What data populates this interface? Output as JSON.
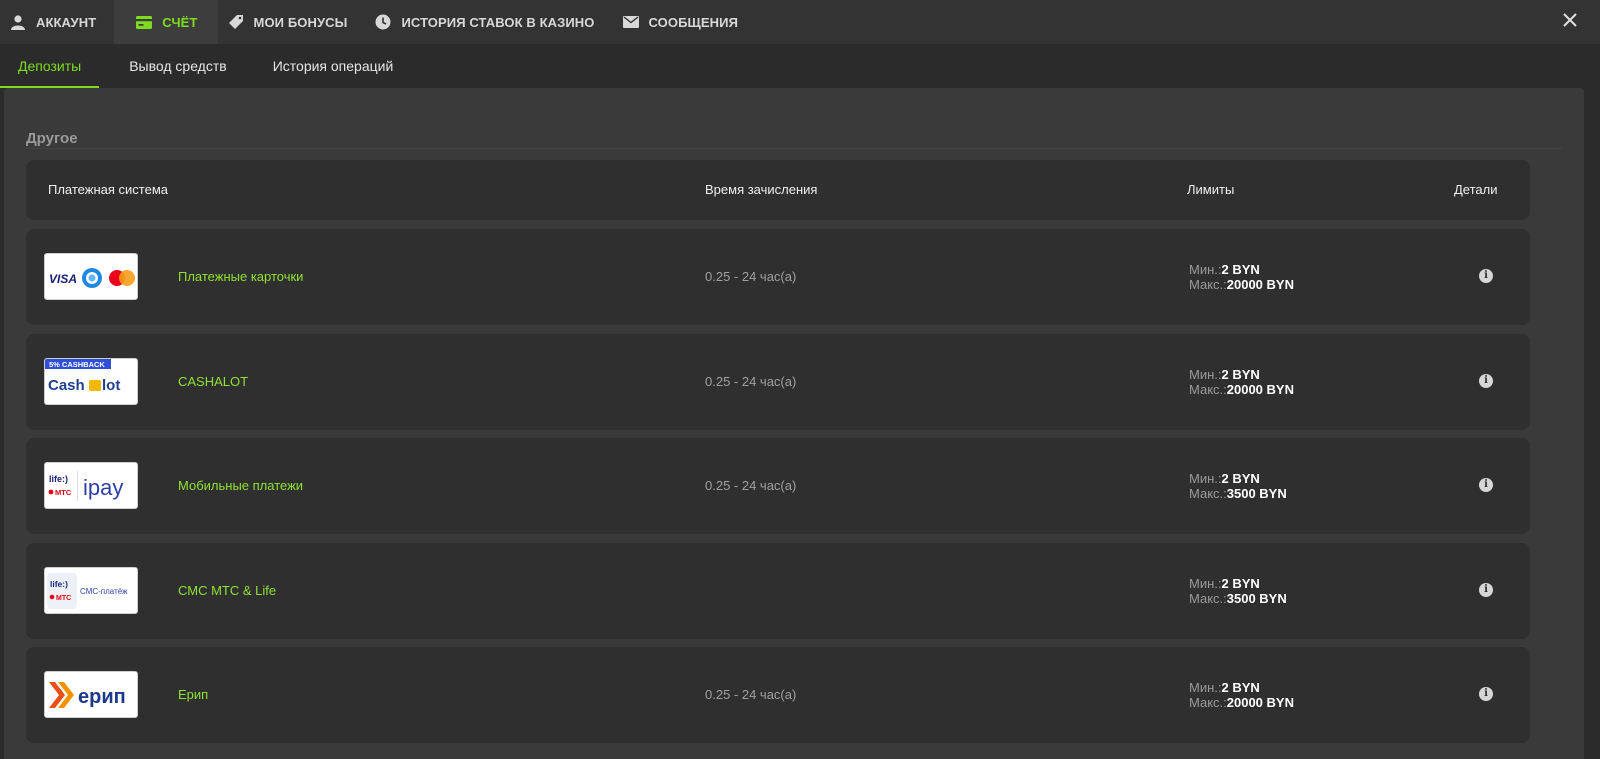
{
  "top_tabs": [
    {
      "label": "АККАУНТ",
      "icon": "user-icon"
    },
    {
      "label": "СЧЁТ",
      "icon": "card-icon",
      "active": true
    },
    {
      "label": "МОИ БОНУСЫ",
      "icon": "tag-icon"
    },
    {
      "label": "ИСТОРИЯ СТАВОК В КАЗИНО",
      "icon": "clock-icon"
    },
    {
      "label": "СООБЩЕНИЯ",
      "icon": "envelope-icon"
    }
  ],
  "close_icon": "close-icon",
  "sub_tabs": [
    {
      "label": "Депозиты",
      "active": true
    },
    {
      "label": "Вывод средств"
    },
    {
      "label": "История операций"
    }
  ],
  "section": {
    "title": "Другое"
  },
  "table_header": {
    "system": "Платежная система",
    "time": "Время зачисления",
    "limits": "Лимиты",
    "details": "Детали"
  },
  "methods": [
    {
      "name": "Платежные карточки",
      "time": "0.25 - 24 час(а)",
      "min_label": "Мин.:",
      "min": "2 BYN",
      "max_label": "Макс.:",
      "max": "20000 BYN",
      "logo": {
        "visa": "VISA"
      }
    },
    {
      "name": "CASHALOT",
      "time": "0.25 - 24 час(а)",
      "min_label": "Мин.:",
      "min": "2 BYN",
      "max_label": "Макс.:",
      "max": "20000 BYN",
      "logo": {
        "badge": "5% CASHBACK",
        "brand_left": "Cash",
        "brand_right": "lot"
      }
    },
    {
      "name": "Мобильные платежи",
      "time": "0.25 - 24 час(а)",
      "min_label": "Мин.:",
      "min": "2 BYN",
      "max_label": "Макс.:",
      "max": "3500 BYN",
      "logo": {
        "life": "life:)",
        "mts": "МТС",
        "ipay": "ipay"
      }
    },
    {
      "name": "СМС МТС & Life",
      "time": "",
      "min_label": "Мин.:",
      "min": "2 BYN",
      "max_label": "Макс.:",
      "max": "3500 BYN",
      "logo": {
        "life": "life:)",
        "mts": "МТС",
        "sms": "СМС-платёж"
      }
    },
    {
      "name": "Ерип",
      "time": "0.25 - 24 час(а)",
      "min_label": "Мин.:",
      "min": "2 BYN",
      "max_label": "Макс.:",
      "max": "20000 BYN",
      "logo": {
        "erip": "ерип"
      }
    }
  ],
  "colors": {
    "accent": "#7ddc1f",
    "name_green": "#8ee231",
    "panel": "#3a3a3a",
    "row": "#2f2f2f"
  }
}
